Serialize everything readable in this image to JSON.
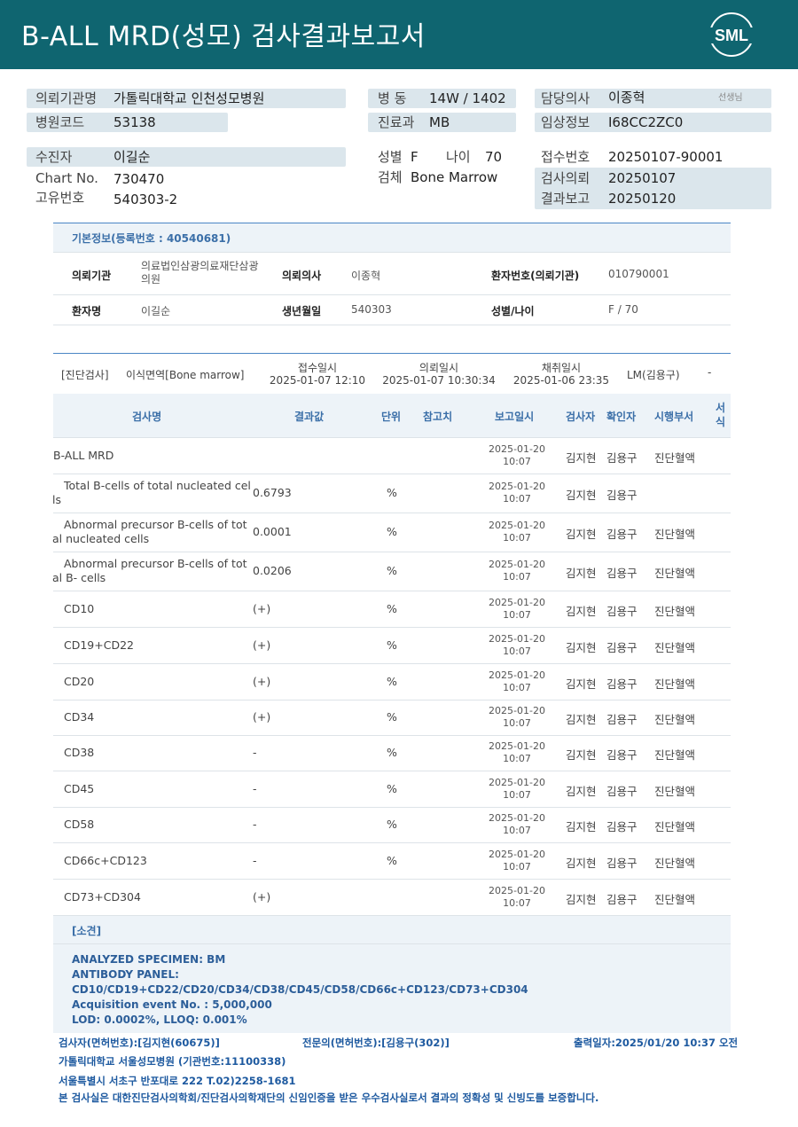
{
  "header": {
    "title": "B-ALL  MRD(성모) 검사결과보고서",
    "logo": "SML"
  },
  "patient_info": {
    "institution_label": "의뢰기관명",
    "institution": "가톨릭대학교 인천성모병원",
    "hospital_code_label": "병원코드",
    "hospital_code": "53138",
    "ward_label": "병  동",
    "ward": "14W / 1402",
    "dept_label": "진료과",
    "dept": "MB",
    "doctor_label": "담당의사",
    "doctor": "이종혁",
    "doctor_suffix": "선생님",
    "clinical_label": "임상정보",
    "clinical": "I68CC2ZC0",
    "patient_label": "수진자",
    "patient": "이길순",
    "chart_label": "Chart No.",
    "chart": "730470",
    "unique_label": "고유번호",
    "unique": "540303-2",
    "sex_label": "성별",
    "sex": "F",
    "age_label": "나이",
    "age": "70",
    "specimen_label": "검체",
    "specimen": "Bone Marrow",
    "receipt_label": "접수번호",
    "receipt": "20250107-90001",
    "request_label": "검사의뢰",
    "request": "20250107",
    "report_label": "결과보고",
    "report": "20250120"
  },
  "basic_info": {
    "title": "기본정보(등록번호 : 40540681)",
    "inst_label": "의뢰기관",
    "inst": "의료법인삼광의료재단삼광의원",
    "doctor_label": "의뢰의사",
    "doctor": "이종혁",
    "pid_label": "환자번호(의뢰기관)",
    "pid": "010790001",
    "name_label": "환자명",
    "name": "이길순",
    "dob_label": "생년월일",
    "dob": "540303",
    "sexage_label": "성별/나이",
    "sexage": "F / 70"
  },
  "test_info": {
    "category": "[진단검사]",
    "specimen": "이식면역[Bone marrow]",
    "receipt_label": "접수일시",
    "receipt": "2025-01-07 12:10",
    "request_label": "의뢰일시",
    "request": "2025-01-07 10:30:34",
    "collect_label": "채취일시",
    "collect": "2025-01-06 23:35",
    "lm": "LM(김용구)",
    "dash": "-"
  },
  "table": {
    "headers": {
      "name": "검사명",
      "result": "결과값",
      "unit": "단위",
      "ref": "참고치",
      "date": "보고일시",
      "tester": "검사자",
      "confirmer": "확인자",
      "dept": "시행부서",
      "form": "서\n식"
    },
    "rows": [
      {
        "name": "B-ALL MRD",
        "result": "",
        "unit": "",
        "date": "2025-01-20",
        "time": "10:07",
        "tester": "김지현",
        "confirmer": "김용구",
        "dept": "진단혈액"
      },
      {
        "name": "Total B-cells of total nucleated cel\nls",
        "result": "0.6793",
        "unit": "%",
        "date": "2025-01-20",
        "time": "10:07",
        "tester": "김지현",
        "confirmer": "김용구",
        "dept": ""
      },
      {
        "name": "Abnormal precursor B-cells of tot\nal nucleated cells",
        "result": "0.0001",
        "unit": "%",
        "date": "2025-01-20",
        "time": "10:07",
        "tester": "김지현",
        "confirmer": "김용구",
        "dept": "진단혈액"
      },
      {
        "name": "Abnormal precursor B-cells of tot\nal B- cells",
        "result": "0.0206",
        "unit": "%",
        "date": "2025-01-20",
        "time": "10:07",
        "tester": "김지현",
        "confirmer": "김용구",
        "dept": "진단혈액"
      },
      {
        "name": "CD10",
        "result": "(+)",
        "unit": "%",
        "date": "2025-01-20",
        "time": "10:07",
        "tester": "김지현",
        "confirmer": "김용구",
        "dept": "진단혈액"
      },
      {
        "name": "CD19+CD22",
        "result": "(+)",
        "unit": "%",
        "date": "2025-01-20",
        "time": "10:07",
        "tester": "김지현",
        "confirmer": "김용구",
        "dept": "진단혈액"
      },
      {
        "name": "CD20",
        "result": "(+)",
        "unit": "%",
        "date": "2025-01-20",
        "time": "10:07",
        "tester": "김지현",
        "confirmer": "김용구",
        "dept": "진단혈액"
      },
      {
        "name": "CD34",
        "result": "(+)",
        "unit": "%",
        "date": "2025-01-20",
        "time": "10:07",
        "tester": "김지현",
        "confirmer": "김용구",
        "dept": "진단혈액"
      },
      {
        "name": "CD38",
        "result": "-",
        "unit": "%",
        "date": "2025-01-20",
        "time": "10:07",
        "tester": "김지현",
        "confirmer": "김용구",
        "dept": "진단혈액"
      },
      {
        "name": "CD45",
        "result": "-",
        "unit": "%",
        "date": "2025-01-20",
        "time": "10:07",
        "tester": "김지현",
        "confirmer": "김용구",
        "dept": "진단혈액"
      },
      {
        "name": "CD58",
        "result": "-",
        "unit": "%",
        "date": "2025-01-20",
        "time": "10:07",
        "tester": "김지현",
        "confirmer": "김용구",
        "dept": "진단혈액"
      },
      {
        "name": "CD66c+CD123",
        "result": "-",
        "unit": "%",
        "date": "2025-01-20",
        "time": "10:07",
        "tester": "김지현",
        "confirmer": "김용구",
        "dept": "진단혈액"
      },
      {
        "name": "CD73+CD304",
        "result": "(+)",
        "unit": "",
        "date": "2025-01-20",
        "time": "10:07",
        "tester": "김지현",
        "confirmer": "김용구",
        "dept": "진단혈액"
      }
    ]
  },
  "opinion": {
    "title": "[소견]",
    "lines": [
      "ANALYZED SPECIMEN: BM",
      "ANTIBODY PANEL:",
      "CD10/CD19+CD22/CD20/CD34/CD38/CD45/CD58/CD66c+CD123/CD73+CD304",
      "Acquisition event No. : 5,000,000",
      "LOD: 0.0002%, LLOQ: 0.001%"
    ]
  },
  "footer": {
    "tester": "검사자(면허번호):[김지현(60675)]",
    "specialist": "전문의(면허번호):[김용구(302)]",
    "printed": "출력일자:2025/01/20 10:37 오전",
    "hospital": "가톨릭대학교 서울성모병원 (기관번호:11100338)",
    "address": "서울특별시 서초구 반포대로 222 T.02)2258-1681",
    "cert": "본 검사실은 대한진단검사의학회/진단검사의학재단의 신임인증을 받은 우수검사실로서 결과의 정확성 및 신빙도를 보증합니다."
  }
}
